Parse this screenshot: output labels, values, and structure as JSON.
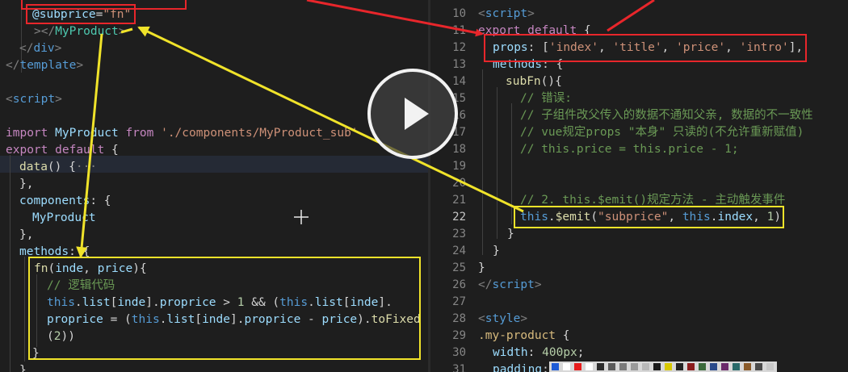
{
  "left_editor": {
    "lines": [
      [
        {
          "c": "tk-attr",
          "t": "@subprice"
        },
        {
          "c": "tk-plain",
          "t": "="
        },
        {
          "c": "tk-str",
          "t": "\"fn\""
        }
      ],
      [
        {
          "c": "tk-punct",
          "t": "></"
        },
        {
          "c": "tk-class",
          "t": "MyProduct"
        },
        {
          "c": "tk-punct",
          "t": ">"
        }
      ],
      [
        {
          "c": "tk-punct",
          "t": "</"
        },
        {
          "c": "tk-tag",
          "t": "div"
        },
        {
          "c": "tk-punct",
          "t": ">"
        }
      ],
      [
        {
          "c": "tk-punct",
          "t": "</"
        },
        {
          "c": "tk-tag",
          "t": "template"
        },
        {
          "c": "tk-punct",
          "t": ">"
        }
      ],
      [],
      [
        {
          "c": "tk-punct",
          "t": "<"
        },
        {
          "c": "tk-tag",
          "t": "script"
        },
        {
          "c": "tk-punct",
          "t": ">"
        }
      ],
      [],
      [
        {
          "c": "tk-kw",
          "t": "import"
        },
        {
          "c": "tk-plain",
          "t": " "
        },
        {
          "c": "tk-attr",
          "t": "MyProduct"
        },
        {
          "c": "tk-plain",
          "t": " "
        },
        {
          "c": "tk-kw",
          "t": "from"
        },
        {
          "c": "tk-plain",
          "t": " "
        },
        {
          "c": "tk-str",
          "t": "'./components/MyProduct_sub'"
        }
      ],
      [
        {
          "c": "tk-kw",
          "t": "export"
        },
        {
          "c": "tk-plain",
          "t": " "
        },
        {
          "c": "tk-kw",
          "t": "default"
        },
        {
          "c": "tk-plain",
          "t": " {"
        }
      ],
      [
        {
          "c": "tk-func",
          "t": "data"
        },
        {
          "c": "tk-plain",
          "t": "() {"
        },
        {
          "c": "tk-punct",
          "t": "···"
        }
      ],
      [
        {
          "c": "tk-plain",
          "t": "},"
        }
      ],
      [
        {
          "c": "tk-prop",
          "t": "components"
        },
        {
          "c": "tk-plain",
          "t": ": {"
        }
      ],
      [
        {
          "c": "tk-attr",
          "t": "MyProduct"
        }
      ],
      [
        {
          "c": "tk-plain",
          "t": "},"
        }
      ],
      [
        {
          "c": "tk-prop",
          "t": "methods"
        },
        {
          "c": "tk-plain",
          "t": ": {"
        }
      ],
      [
        {
          "c": "tk-func",
          "t": "fn"
        },
        {
          "c": "tk-plain",
          "t": "("
        },
        {
          "c": "tk-attr",
          "t": "inde"
        },
        {
          "c": "tk-plain",
          "t": ", "
        },
        {
          "c": "tk-attr",
          "t": "price"
        },
        {
          "c": "tk-plain",
          "t": "){"
        }
      ],
      [
        {
          "c": "tk-comment",
          "t": "// 逻辑代码"
        }
      ],
      [
        {
          "c": "tk-this",
          "t": "this"
        },
        {
          "c": "tk-plain",
          "t": "."
        },
        {
          "c": "tk-prop",
          "t": "list"
        },
        {
          "c": "tk-plain",
          "t": "["
        },
        {
          "c": "tk-attr",
          "t": "inde"
        },
        {
          "c": "tk-plain",
          "t": "]."
        },
        {
          "c": "tk-prop",
          "t": "proprice"
        },
        {
          "c": "tk-plain",
          "t": " > "
        },
        {
          "c": "tk-num",
          "t": "1"
        },
        {
          "c": "tk-plain",
          "t": " && ("
        },
        {
          "c": "tk-this",
          "t": "this"
        },
        {
          "c": "tk-plain",
          "t": "."
        },
        {
          "c": "tk-prop",
          "t": "list"
        },
        {
          "c": "tk-plain",
          "t": "["
        },
        {
          "c": "tk-attr",
          "t": "inde"
        },
        {
          "c": "tk-plain",
          "t": "]."
        }
      ],
      [
        {
          "c": "tk-prop",
          "t": "proprice"
        },
        {
          "c": "tk-plain",
          "t": " = ("
        },
        {
          "c": "tk-this",
          "t": "this"
        },
        {
          "c": "tk-plain",
          "t": "."
        },
        {
          "c": "tk-prop",
          "t": "list"
        },
        {
          "c": "tk-plain",
          "t": "["
        },
        {
          "c": "tk-attr",
          "t": "inde"
        },
        {
          "c": "tk-plain",
          "t": "]."
        },
        {
          "c": "tk-prop",
          "t": "proprice"
        },
        {
          "c": "tk-plain",
          "t": " - "
        },
        {
          "c": "tk-attr",
          "t": "price"
        },
        {
          "c": "tk-plain",
          "t": ")."
        },
        {
          "c": "tk-func",
          "t": "toFixed"
        }
      ],
      [
        {
          "c": "tk-plain",
          "t": "("
        },
        {
          "c": "tk-num",
          "t": "2"
        },
        {
          "c": "tk-plain",
          "t": "))"
        }
      ],
      [
        {
          "c": "tk-plain",
          "t": "}"
        }
      ],
      [
        {
          "c": "tk-plain",
          "t": "}"
        }
      ]
    ]
  },
  "right_editor": {
    "lines": [
      {
        "n": "10",
        "tokens": [
          {
            "c": "tk-punct",
            "t": "<"
          },
          {
            "c": "tk-tag",
            "t": "script"
          },
          {
            "c": "tk-punct",
            "t": ">"
          }
        ]
      },
      {
        "n": "11",
        "tokens": [
          {
            "c": "tk-kw",
            "t": "export"
          },
          {
            "c": "tk-plain",
            "t": " "
          },
          {
            "c": "tk-kw",
            "t": "default"
          },
          {
            "c": "tk-plain",
            "t": " {"
          }
        ]
      },
      {
        "n": "12",
        "tokens": [
          {
            "c": "tk-prop",
            "t": "props"
          },
          {
            "c": "tk-plain",
            "t": ": ["
          },
          {
            "c": "tk-str",
            "t": "'index'"
          },
          {
            "c": "tk-plain",
            "t": ", "
          },
          {
            "c": "tk-str",
            "t": "'title'"
          },
          {
            "c": "tk-plain",
            "t": ", "
          },
          {
            "c": "tk-str",
            "t": "'price'"
          },
          {
            "c": "tk-plain",
            "t": ", "
          },
          {
            "c": "tk-str",
            "t": "'intro'"
          },
          {
            "c": "tk-plain",
            "t": "],"
          }
        ]
      },
      {
        "n": "13",
        "tokens": [
          {
            "c": "tk-prop",
            "t": "methods"
          },
          {
            "c": "tk-plain",
            "t": ": {"
          }
        ]
      },
      {
        "n": "14",
        "tokens": [
          {
            "c": "tk-func",
            "t": "subFn"
          },
          {
            "c": "tk-plain",
            "t": "(){"
          }
        ]
      },
      {
        "n": "15",
        "tokens": [
          {
            "c": "tk-comment",
            "t": "// 错误:"
          }
        ]
      },
      {
        "n": "16",
        "tokens": [
          {
            "c": "tk-comment",
            "t": "// 子组件改父传入的数据不通知父亲, 数据的不一致性"
          }
        ]
      },
      {
        "n": "17",
        "tokens": [
          {
            "c": "tk-comment",
            "t": "// vue规定props \"本身\" 只读的(不允许重新赋值)"
          }
        ]
      },
      {
        "n": "18",
        "tokens": [
          {
            "c": "tk-comment",
            "t": "// this.price = this.price - 1;"
          }
        ]
      },
      {
        "n": "19",
        "tokens": []
      },
      {
        "n": "20",
        "tokens": []
      },
      {
        "n": "21",
        "tokens": [
          {
            "c": "tk-comment",
            "t": "// 2. this.$emit()规定方法 - 主动触发事件"
          }
        ]
      },
      {
        "n": "22",
        "tokens": [
          {
            "c": "tk-this",
            "t": "this"
          },
          {
            "c": "tk-plain",
            "t": "."
          },
          {
            "c": "tk-func",
            "t": "$emit"
          },
          {
            "c": "tk-plain",
            "t": "("
          },
          {
            "c": "tk-str",
            "t": "\"subprice\""
          },
          {
            "c": "tk-plain",
            "t": ", "
          },
          {
            "c": "tk-this",
            "t": "this"
          },
          {
            "c": "tk-plain",
            "t": "."
          },
          {
            "c": "tk-prop",
            "t": "index"
          },
          {
            "c": "tk-plain",
            "t": ", "
          },
          {
            "c": "tk-num",
            "t": "1"
          },
          {
            "c": "tk-plain",
            "t": ")"
          }
        ]
      },
      {
        "n": "23",
        "tokens": [
          {
            "c": "tk-plain",
            "t": "}"
          }
        ]
      },
      {
        "n": "24",
        "tokens": [
          {
            "c": "tk-plain",
            "t": "}"
          }
        ]
      },
      {
        "n": "25",
        "tokens": [
          {
            "c": "tk-plain",
            "t": "}"
          }
        ]
      },
      {
        "n": "26",
        "tokens": [
          {
            "c": "tk-punct",
            "t": "</"
          },
          {
            "c": "tk-tag",
            "t": "script"
          },
          {
            "c": "tk-punct",
            "t": ">"
          }
        ]
      },
      {
        "n": "27",
        "tokens": []
      },
      {
        "n": "28",
        "tokens": [
          {
            "c": "tk-punct",
            "t": "<"
          },
          {
            "c": "tk-tag",
            "t": "style"
          },
          {
            "c": "tk-punct",
            "t": ">"
          }
        ]
      },
      {
        "n": "29",
        "tokens": [
          {
            "c": "tk-sel",
            "t": ".my-product"
          },
          {
            "c": "tk-plain",
            "t": " {"
          }
        ]
      },
      {
        "n": "30",
        "tokens": [
          {
            "c": "tk-prop",
            "t": "width"
          },
          {
            "c": "tk-plain",
            "t": ": "
          },
          {
            "c": "tk-num",
            "t": "400px"
          },
          {
            "c": "tk-plain",
            "t": ";"
          }
        ]
      },
      {
        "n": "31",
        "tokens": [
          {
            "c": "tk-prop",
            "t": "padding"
          },
          {
            "c": "tk-plain",
            "t": ": "
          }
        ]
      }
    ]
  },
  "video": {
    "play_icon": "play-icon"
  },
  "annotation_colors": {
    "red": "#e8262b",
    "yellow": "#f0e32a"
  },
  "palette_colors": [
    "#1e5bd6",
    "#ffffff",
    "#e81c1c",
    "#ffffff",
    "#2b2b2b",
    "#5a5a5a",
    "#7a7a7a",
    "#9a9a9a",
    "#b8b8b8",
    "#1a1a1a",
    "#d8c800",
    "#222222",
    "#8a1c1c",
    "#3a6a3a",
    "#2a4a8a",
    "#6a2a6a",
    "#2a6a6a",
    "#8a5a2a",
    "#4a4a4a",
    "#c8c8c8"
  ]
}
